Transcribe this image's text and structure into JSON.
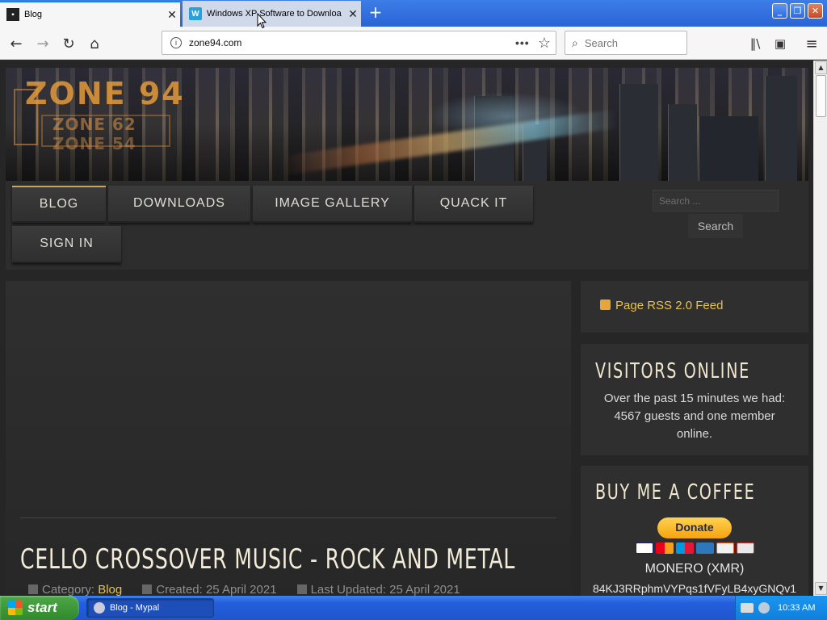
{
  "browser": {
    "tabs": [
      {
        "title": "Blog",
        "icon": "blog-favicon"
      },
      {
        "title": "Windows XP Software to Downloa",
        "icon": "w-favicon"
      }
    ],
    "address": "zone94.com",
    "search_placeholder": "Search",
    "new_tab_glyph": "+",
    "close_glyph": "✕"
  },
  "site": {
    "logo": {
      "main": "ZONE 94",
      "sub1": "ZONE 62",
      "sub2": "ZONE 54"
    },
    "menu": [
      "BLOG",
      "DOWNLOADS",
      "IMAGE GALLERY",
      "QUACK IT",
      "SIGN IN"
    ],
    "search_placeholder": "Search ...",
    "search_button": "Search"
  },
  "article": {
    "title": "CELLO CROSSOVER MUSIC - ROCK AND METAL",
    "category_label": "Category:",
    "category": "Blog",
    "created": "Created: 25 April 2021",
    "updated": "Last Updated: 25 April 2021"
  },
  "sidebar": {
    "rss": "Page RSS 2.0 Feed",
    "visitors": {
      "heading": "VISITORS ONLINE",
      "text": "Over the past 15 minutes we had: 4567 guests and one member online."
    },
    "coffee": {
      "heading": "BUY ME A COFFEE",
      "donate": "Donate",
      "currency": "MONERO (XMR)",
      "address": "84KJ3RRphmVYPqs1fVFyLB4xyGNQv1"
    }
  },
  "taskbar": {
    "start": "start",
    "task": "Blog - Mypal",
    "clock": "10:33 AM"
  },
  "colors": {
    "accent_gold": "#e7c24f",
    "title_cream": "#f2ecd8",
    "xp_blue": "#245edb",
    "start_green": "#3c9a38"
  }
}
